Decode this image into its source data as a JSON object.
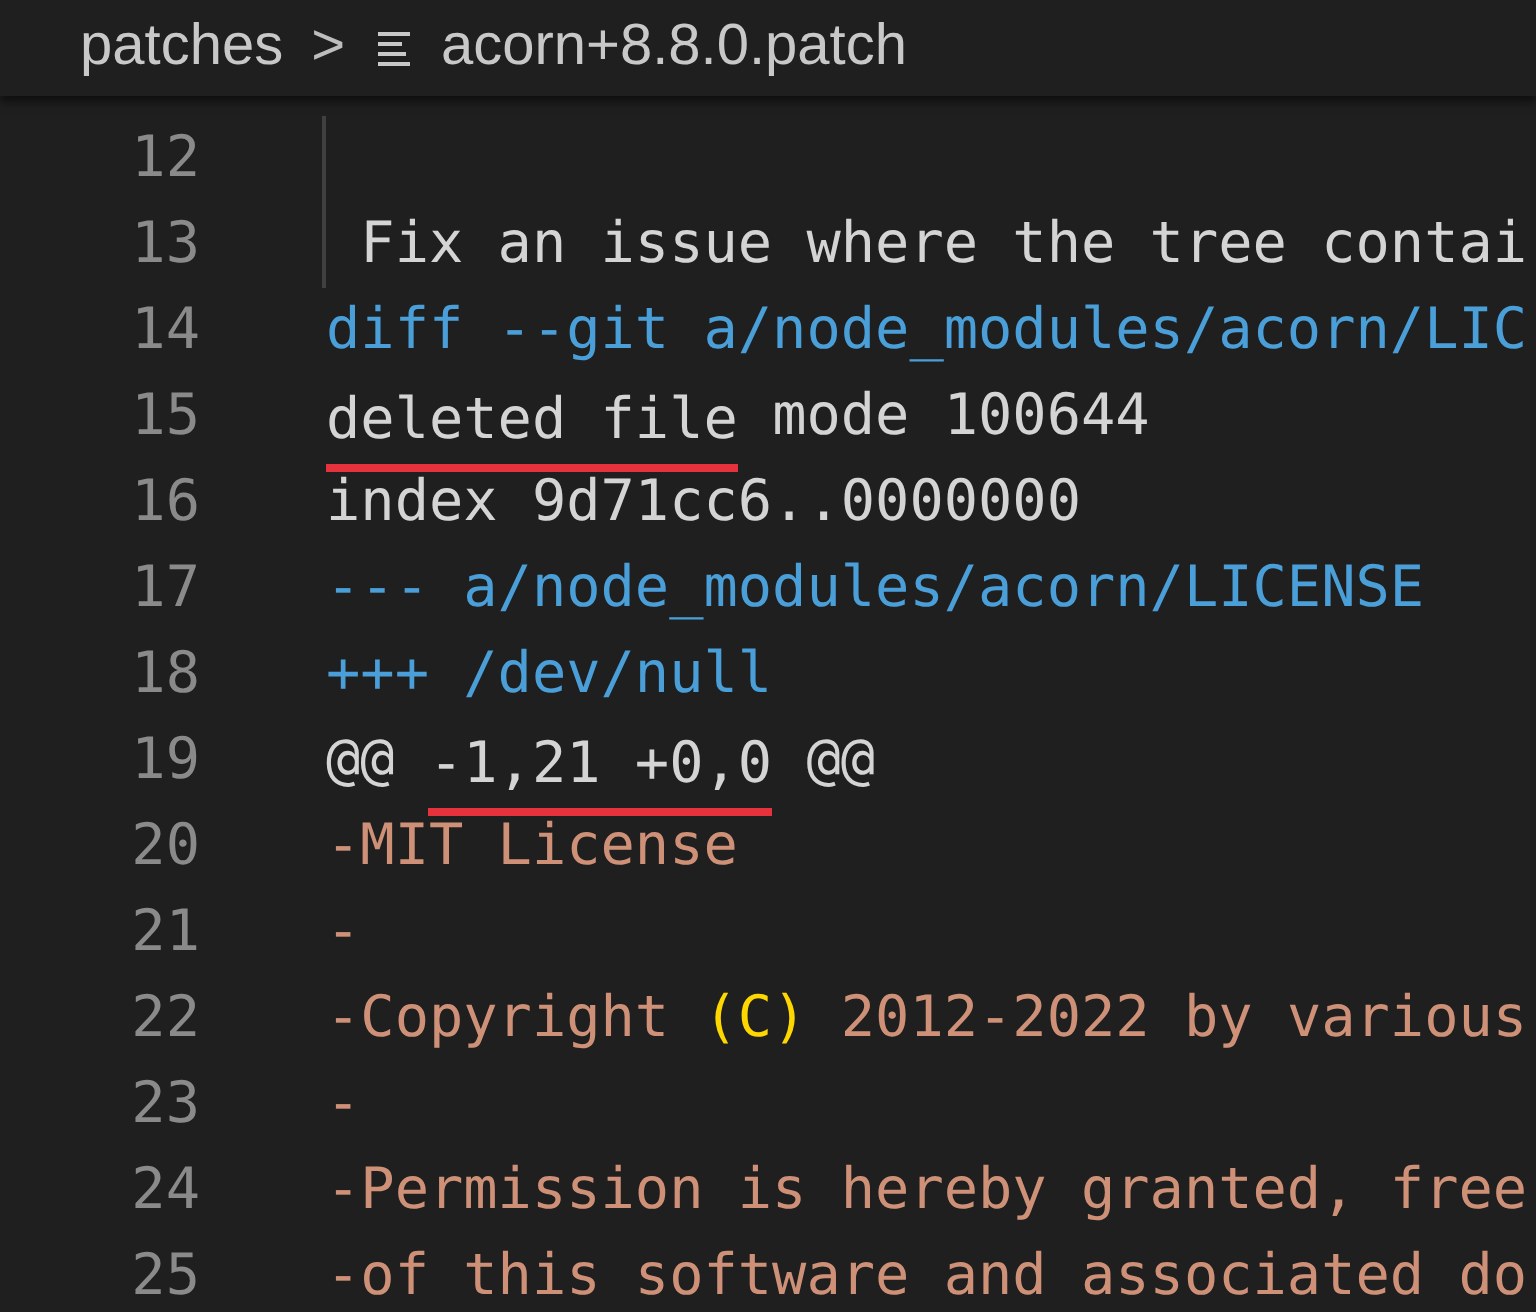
{
  "breadcrumb": {
    "folder": "patches",
    "separator": ">",
    "file": "acorn+8.8.0.patch"
  },
  "lines": [
    {
      "number": "12",
      "indent_guide": true
    },
    {
      "number": "13",
      "indent_guide": true,
      "segments": [
        {
          "kind": "plain",
          "text": " Fix an issue where the tree contai",
          "underlined": false
        }
      ]
    },
    {
      "number": "14",
      "indent_guide": false,
      "segments": [
        {
          "kind": "meta",
          "text": "diff --git a/node_modules/acorn/LIC",
          "underlined": false
        }
      ]
    },
    {
      "number": "15",
      "indent_guide": false,
      "segments": [
        {
          "kind": "plain",
          "text": "deleted file",
          "underlined": true
        },
        {
          "kind": "plain",
          "text": " mode 100644",
          "underlined": false
        }
      ]
    },
    {
      "number": "16",
      "indent_guide": false,
      "segments": [
        {
          "kind": "plain",
          "text": "index 9d71cc6..0000000",
          "underlined": false
        }
      ]
    },
    {
      "number": "17",
      "indent_guide": false,
      "segments": [
        {
          "kind": "meta",
          "text": "--- a/node_modules/acorn/LICENSE",
          "underlined": false
        }
      ]
    },
    {
      "number": "18",
      "indent_guide": false,
      "segments": [
        {
          "kind": "meta",
          "text": "+++ /dev/null",
          "underlined": false
        }
      ]
    },
    {
      "number": "19",
      "indent_guide": false,
      "segments": [
        {
          "kind": "plain",
          "text": "@@ ",
          "underlined": false
        },
        {
          "kind": "plain",
          "text": "-1,21 +0,0",
          "underlined": true
        },
        {
          "kind": "plain",
          "text": " @@",
          "underlined": false
        }
      ]
    },
    {
      "number": "20",
      "indent_guide": false,
      "segments": [
        {
          "kind": "deleted",
          "text": "-MIT License",
          "underlined": false
        }
      ]
    },
    {
      "number": "21",
      "indent_guide": false,
      "segments": [
        {
          "kind": "deleted",
          "text": "-",
          "underlined": false
        }
      ]
    },
    {
      "number": "22",
      "indent_guide": false,
      "segments": [
        {
          "kind": "deleted",
          "text": "-Copyright ",
          "underlined": false
        },
        {
          "kind": "bracket",
          "text": "(C)",
          "underlined": false
        },
        {
          "kind": "deleted",
          "text": " 2012-2022 by various",
          "underlined": false
        }
      ]
    },
    {
      "number": "23",
      "indent_guide": false,
      "segments": [
        {
          "kind": "deleted",
          "text": "-",
          "underlined": false
        }
      ]
    },
    {
      "number": "24",
      "indent_guide": false,
      "segments": [
        {
          "kind": "deleted",
          "text": "-Permission is hereby granted, free",
          "underlined": false
        }
      ]
    },
    {
      "number": "25",
      "indent_guide": false,
      "segments": [
        {
          "kind": "deleted",
          "text": "-of this software and associated do",
          "underlined": false
        }
      ]
    }
  ]
}
